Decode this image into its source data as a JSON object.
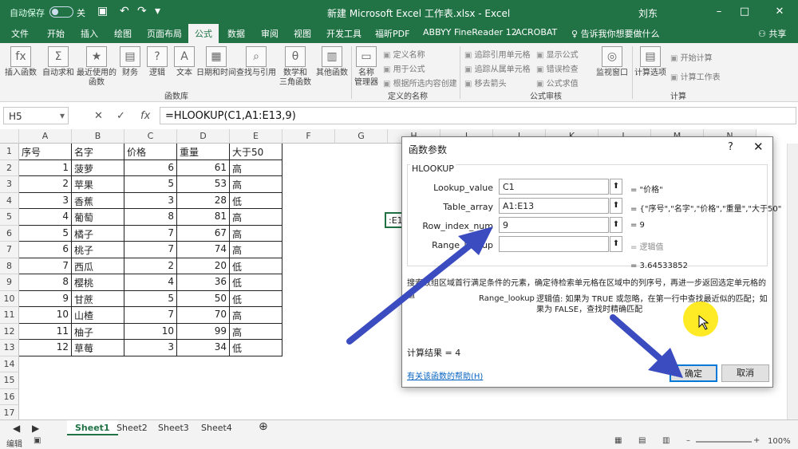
{
  "titlebar": {
    "autosave_label": "自动保存",
    "autosave_state": "关",
    "doc_title": "新建 Microsoft Excel 工作表.xlsx  -  Excel",
    "user": "刘东"
  },
  "tabs": [
    "文件",
    "开始",
    "插入",
    "绘图",
    "页面布局",
    "公式",
    "数据",
    "审阅",
    "视图",
    "开发工具",
    "福昕PDF",
    "ABBYY FineReader 12",
    "ACROBAT"
  ],
  "active_tab": "公式",
  "tell_me": "告诉我你想要做什么",
  "share": "共享",
  "ribbon": {
    "buttons": [
      "插入函数",
      "自动求和",
      "最近使用的\n函数",
      "财务",
      "逻辑",
      "文本",
      "日期和时间",
      "查找与引用",
      "数学和\n三角函数",
      "其他函数",
      "名称\n管理器",
      "监视窗口",
      "计算选项"
    ],
    "small": [
      "定义名称",
      "用于公式",
      "根据所选内容创建",
      "追踪引用单元格",
      "追踪从属单元格",
      "移去箭头",
      "显示公式",
      "错误检查",
      "公式求值",
      "开始计算",
      "计算工作表"
    ],
    "groups": [
      "函数库",
      "定义的名称",
      "公式审核",
      "计算"
    ]
  },
  "formula_bar": {
    "name_box": "H5",
    "formula": "=HLOOKUP(C1,A1:E13,9)"
  },
  "columns": [
    "A",
    "B",
    "C",
    "D",
    "E",
    "F",
    "G",
    "H",
    "I",
    "J",
    "K",
    "L",
    "M",
    "N"
  ],
  "rows": [
    [
      "序号",
      "名字",
      "价格",
      "重量",
      "大于50"
    ],
    [
      "1",
      "菠萝",
      "6",
      "61",
      "高"
    ],
    [
      "2",
      "苹果",
      "5",
      "53",
      "高"
    ],
    [
      "3",
      "香蕉",
      "3",
      "28",
      "低"
    ],
    [
      "4",
      "葡萄",
      "8",
      "81",
      "高"
    ],
    [
      "5",
      "橘子",
      "7",
      "67",
      "高"
    ],
    [
      "6",
      "桃子",
      "7",
      "74",
      "高"
    ],
    [
      "7",
      "西瓜",
      "2",
      "20",
      "低"
    ],
    [
      "8",
      "樱桃",
      "4",
      "36",
      "低"
    ],
    [
      "9",
      "甘蔗",
      "5",
      "50",
      "低"
    ],
    [
      "10",
      "山楂",
      "7",
      "70",
      "高"
    ],
    [
      "11",
      "柚子",
      "10",
      "99",
      "高"
    ],
    [
      "12",
      "草莓",
      "3",
      "34",
      "低"
    ]
  ],
  "h5_preview": ":E1",
  "dialog": {
    "title": "函数参数",
    "function": "HLOOKUP",
    "args": [
      {
        "label": "Lookup_value",
        "value": "C1",
        "result": "= \"价格\""
      },
      {
        "label": "Table_array",
        "value": "A1:E13",
        "result": "= {\"序号\",\"名字\",\"价格\",\"重量\",\"大于50\""
      },
      {
        "label": "Row_index_num",
        "value": "9",
        "result": "= 9"
      },
      {
        "label": "Range_lookup",
        "value": "",
        "result": "= 逻辑值"
      }
    ],
    "total": "= 3.64533852",
    "description": "搜索数组区域首行满足条件的元素，确定待检索单元格在区域中的列序号，再进一步返回选定单元格的值",
    "param_name": "Range_lookup",
    "param_desc": "逻辑值: 如果为 TRUE 或忽略，在第一行中查找最近似的匹配；如果为 FALSE，查找时精确匹配",
    "calc_result": "计算结果 =   4",
    "help": "有关该函数的帮助(H)",
    "ok": "确定",
    "cancel": "取消"
  },
  "sheets": [
    "Sheet1",
    "Sheet2",
    "Sheet3",
    "Sheet4"
  ],
  "active_sheet": "Sheet1",
  "status": {
    "mode": "编辑",
    "zoom": "100%"
  },
  "colors": {
    "excel_green": "#217346",
    "arrow_blue": "#3b4cc0",
    "cursor_yellow": "#ffe600"
  }
}
